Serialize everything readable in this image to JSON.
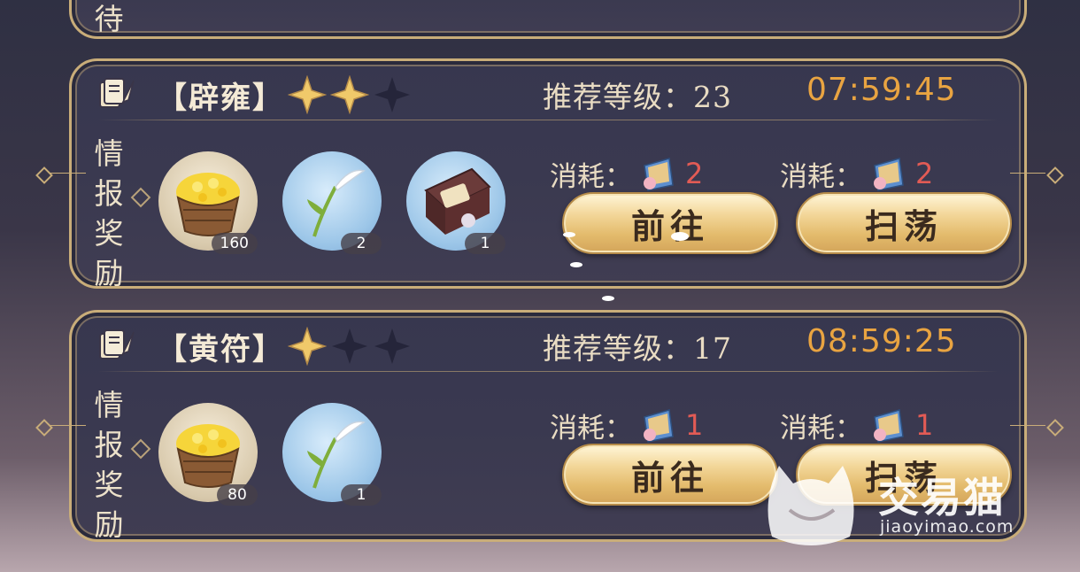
{
  "top_card": {
    "label_char": "待"
  },
  "cards": [
    {
      "title": "【辟雍】",
      "stars_filled": 2,
      "stars_total": 3,
      "level_label": "推荐等级：23",
      "timer": "07:59:45",
      "reward_label": [
        "情",
        "报",
        "奖",
        "励"
      ],
      "rewards": [
        {
          "icon": "coin-basket-icon",
          "qty": "160"
        },
        {
          "icon": "feather-reed-icon",
          "qty": "2"
        },
        {
          "icon": "treasure-chest-icon",
          "qty": "1"
        }
      ],
      "costs": [
        {
          "label": "消耗：",
          "icon": "ticket-icon",
          "num": "2"
        },
        {
          "label": "消耗：",
          "icon": "ticket-icon",
          "num": "2"
        }
      ],
      "buttons": {
        "go": "前往",
        "sweep": "扫荡"
      }
    },
    {
      "title": "【黄符】",
      "stars_filled": 1,
      "stars_total": 3,
      "level_label": "推荐等级：17",
      "timer": "08:59:25",
      "reward_label": [
        "情",
        "报",
        "奖",
        "励"
      ],
      "rewards": [
        {
          "icon": "coin-basket-icon",
          "qty": "80"
        },
        {
          "icon": "feather-reed-icon",
          "qty": "1"
        }
      ],
      "costs": [
        {
          "label": "消耗：",
          "icon": "ticket-icon",
          "num": "1"
        },
        {
          "label": "消耗：",
          "icon": "ticket-icon",
          "num": "1"
        }
      ],
      "buttons": {
        "go": "前往",
        "sweep": "扫荡"
      }
    }
  ],
  "watermark": {
    "brand": "交易猫",
    "url": "jiaoyimao.com"
  },
  "colors": {
    "gold": "#c9ad79",
    "timer": "#e9a441",
    "cost_num": "#e25b55",
    "panel": "#37374f"
  }
}
